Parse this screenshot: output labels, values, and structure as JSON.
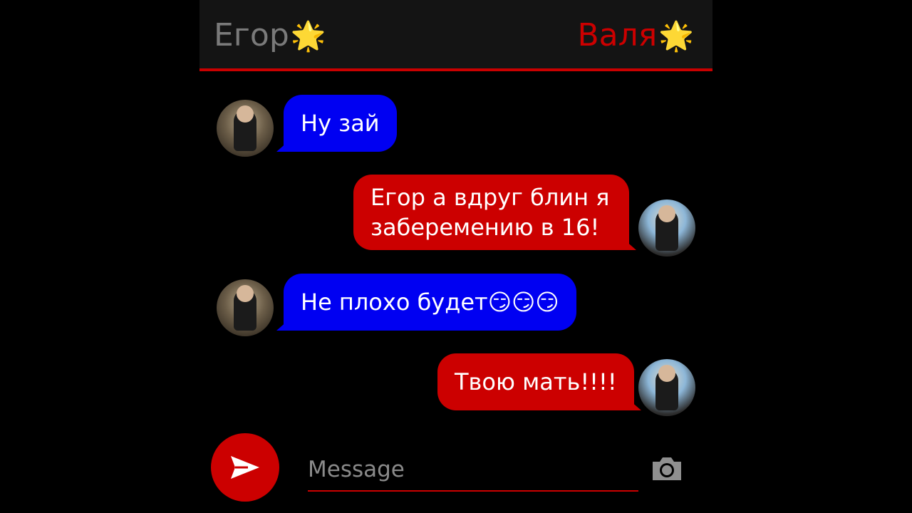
{
  "header": {
    "left_name": "Егор",
    "right_name": "Валя",
    "star_icon": "🌟"
  },
  "messages": [
    {
      "sender": "Егор",
      "side": "left",
      "text": "Ну зай"
    },
    {
      "sender": "Валя",
      "side": "right",
      "line1": "Егор а вдруг блин я",
      "line2": "заберемению в 16!"
    },
    {
      "sender": "Егор",
      "side": "left",
      "text": "Не плохо будет😏😏😏"
    },
    {
      "sender": "Валя",
      "side": "right",
      "text": "Твою мать!!!!"
    }
  ],
  "composer": {
    "placeholder": "Message",
    "send_icon": "send-arrow-icon",
    "camera_icon": "camera-icon"
  },
  "colors": {
    "left_bubble": "#0000f2",
    "right_bubble": "#cc0000",
    "accent": "#cc0000",
    "background": "#000000",
    "header_bg": "#141414",
    "left_name": "#7a7a7a"
  }
}
